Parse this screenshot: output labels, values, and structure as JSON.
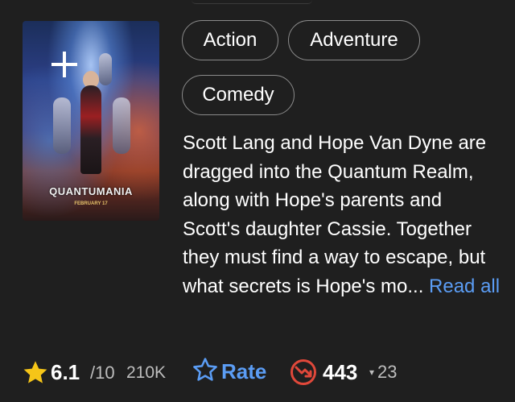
{
  "poster": {
    "title_text": "QUANTUMANIA",
    "date_text": "FEBRUARY 17"
  },
  "genres": [
    "Action",
    "Adventure",
    "Comedy"
  ],
  "plot": {
    "text": "Scott Lang and Hope Van Dyne are dragged into the Quantum Realm, along with Hope's parents and Scott's daughter Cassie. Together they must find a way to escape, but what secrets is Hope's mo... ",
    "read_more": "Read all"
  },
  "rating": {
    "value": "6.1",
    "max": "/10",
    "count": "210K"
  },
  "rate": {
    "label": "Rate"
  },
  "popularity": {
    "rank": "443",
    "change": "23",
    "direction": "down"
  },
  "colors": {
    "background": "#1f1f1f",
    "accent_blue": "#5b9df5",
    "star_yellow": "#f5c518",
    "meter_red": "#e0483a"
  }
}
